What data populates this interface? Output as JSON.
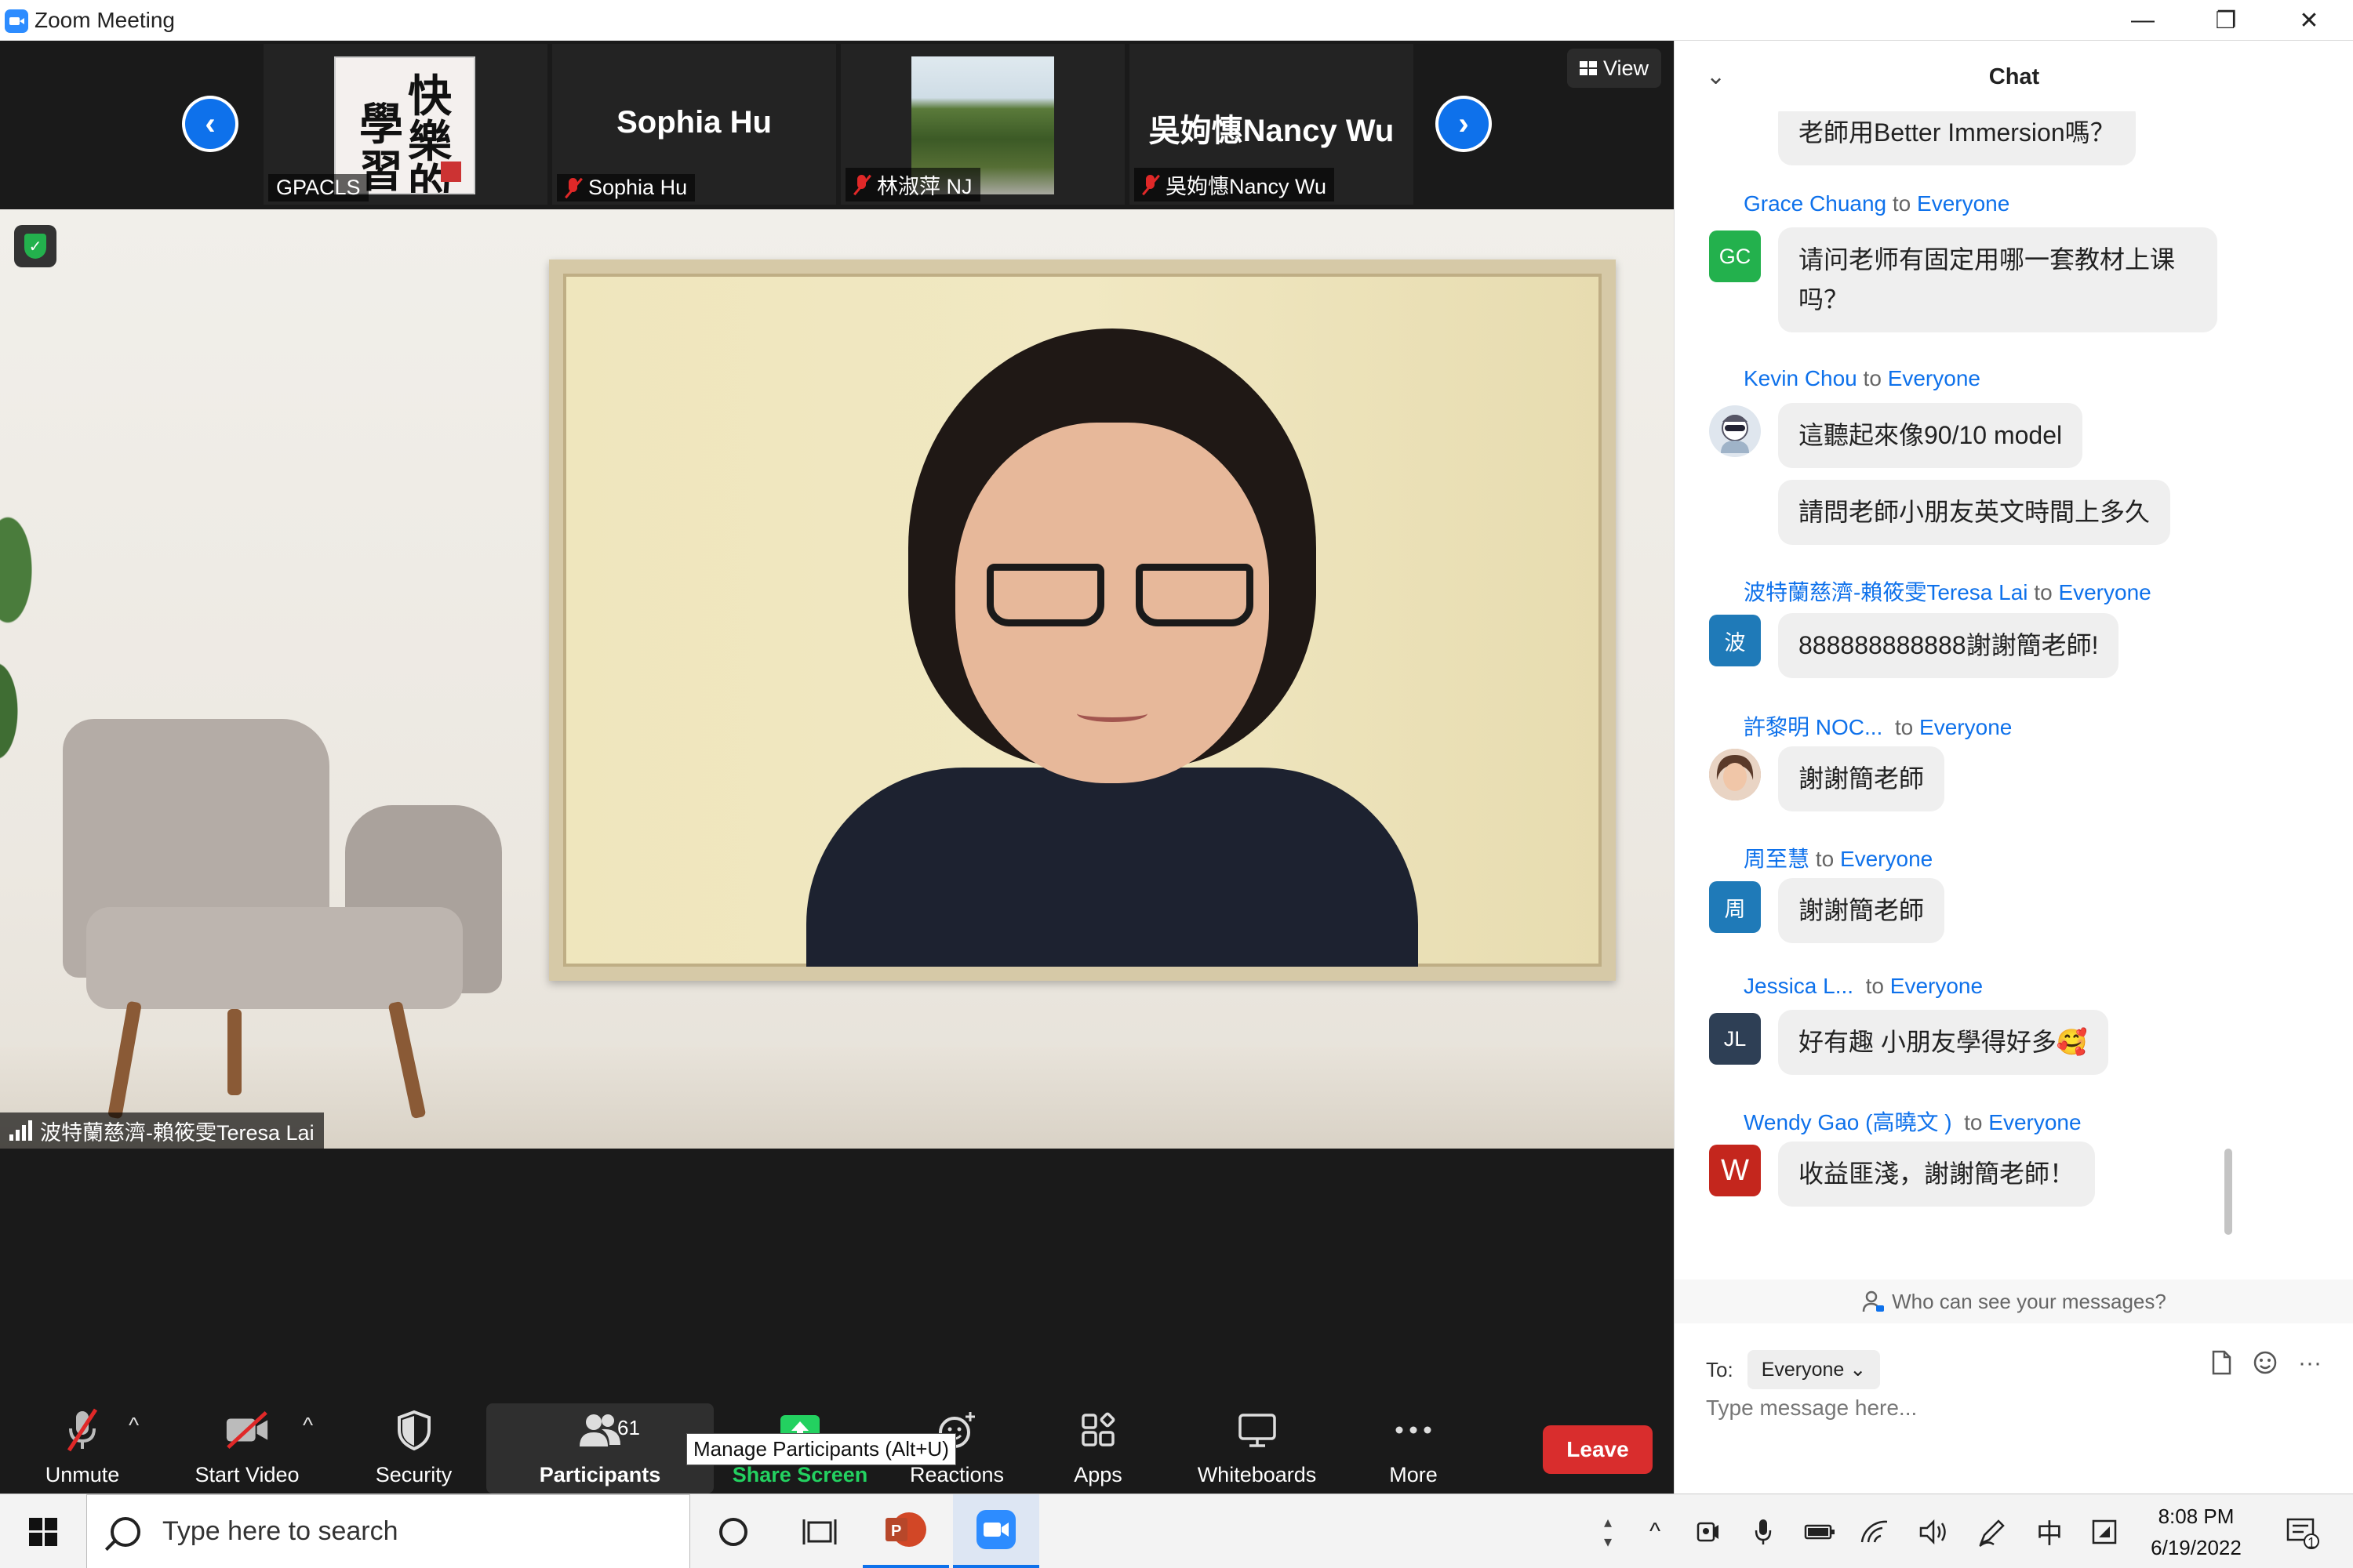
{
  "window": {
    "title": "Zoom Meeting",
    "minimize": "—",
    "restore": "❐",
    "close": "✕"
  },
  "gallery": {
    "prev_arrow": "‹",
    "next_arrow": "›",
    "view_label": "View",
    "tiles": [
      {
        "label": "GPACLS",
        "image_text": [
          "快",
          "樂",
          "的",
          "學",
          "習"
        ]
      },
      {
        "center_name": "Sophia Hu",
        "label": "Sophia Hu",
        "muted": true
      },
      {
        "label": "林淑萍 NJ",
        "muted": true
      },
      {
        "center_name": "吳姁憓Nancy Wu",
        "label": "吳姁憓Nancy Wu",
        "muted": true
      }
    ]
  },
  "main": {
    "speaker_name": "波特蘭慈濟-賴筱雯Teresa Lai",
    "shield_glyph": "✓"
  },
  "toolbar": {
    "unmute": "Unmute",
    "start_video": "Start Video",
    "security": "Security",
    "participants": "Participants",
    "participants_count": "61",
    "share_screen": "Share Screen",
    "reactions": "Reactions",
    "apps": "Apps",
    "whiteboards": "Whiteboards",
    "more": "More",
    "leave": "Leave",
    "tooltip": "Manage Participants (Alt+U)",
    "caret": "^"
  },
  "chat": {
    "title": "Chat",
    "collapse_glyph": "⌄",
    "partial_message": "老師用Better Immersion嗎？",
    "messages": [
      {
        "sender": "Grace Chuang",
        "to_word": "to",
        "recipient": "Everyone",
        "avatar": "GC",
        "avatar_color": "#23b14d",
        "bubbles": [
          "请问老师有固定用哪一套教材上课吗？"
        ]
      },
      {
        "sender": "Kevin Chou",
        "to_word": "to",
        "recipient": "Everyone",
        "avatar": "",
        "avatar_color": "#dfe6ee",
        "bubbles": [
          "這聽起來像90/10 model",
          "請問老師小朋友英文時間上多久"
        ]
      },
      {
        "sender": "波特蘭慈濟-賴筱雯Teresa Lai",
        "to_word": "to",
        "recipient": "Everyone",
        "avatar": "波",
        "avatar_color": "#1f7ab8",
        "bubbles": [
          "888888888888謝謝簡老師!"
        ]
      },
      {
        "sender": "許黎明 NOC...",
        "to_word": "to",
        "recipient": "Everyone",
        "avatar": "",
        "avatar_color": "#c99c84",
        "bubbles": [
          "謝謝簡老師"
        ]
      },
      {
        "sender": "周至慧",
        "to_word": "to",
        "recipient": "Everyone",
        "avatar": "周",
        "avatar_color": "#1f7ab8",
        "bubbles": [
          "謝謝簡老師"
        ]
      },
      {
        "sender": "Jessica L...",
        "to_word": "to",
        "recipient": "Everyone",
        "avatar": "JL",
        "avatar_color": "#2e3f55",
        "bubbles": [
          "好有趣 小朋友學得好多🥰"
        ]
      },
      {
        "sender": "Wendy Gao (高曉文 )",
        "to_word": "to",
        "recipient": "Everyone",
        "avatar": "W",
        "avatar_color": "#c4261d",
        "bubbles": [
          "收益匪淺，謝謝簡老師！"
        ]
      }
    ],
    "who_can_see": "Who can see your messages?",
    "to_label": "To:",
    "to_value": "Everyone",
    "input_placeholder": "Type message here...",
    "more_glyph": "···"
  },
  "taskbar": {
    "search_placeholder": "Type here to search",
    "time": "8:08 PM",
    "date": "6/19/2022",
    "ime": "中",
    "notification_count": "1"
  },
  "colors": {
    "accent": "#0e71eb",
    "leave": "#d92d2d",
    "share_green": "#23d160"
  }
}
